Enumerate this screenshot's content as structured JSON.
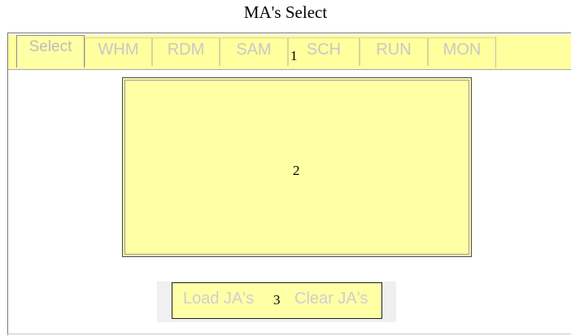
{
  "window": {
    "title": "MA's Select"
  },
  "tabs": [
    {
      "label": "Select",
      "active": true
    },
    {
      "label": "WHM"
    },
    {
      "label": "RDM"
    },
    {
      "label": "SAM"
    },
    {
      "label": "SCH"
    },
    {
      "label": "RUN"
    },
    {
      "label": "MON"
    }
  ],
  "markers": {
    "tabs": "1",
    "panel": "2",
    "buttons": "3"
  },
  "buttons": {
    "load": "Load JA's",
    "clear": "Clear JA's"
  },
  "colors": {
    "tab_bg": "#ffff9e",
    "panel_bg": "#ffffa6",
    "disabled_text": "#c9c9c9"
  }
}
